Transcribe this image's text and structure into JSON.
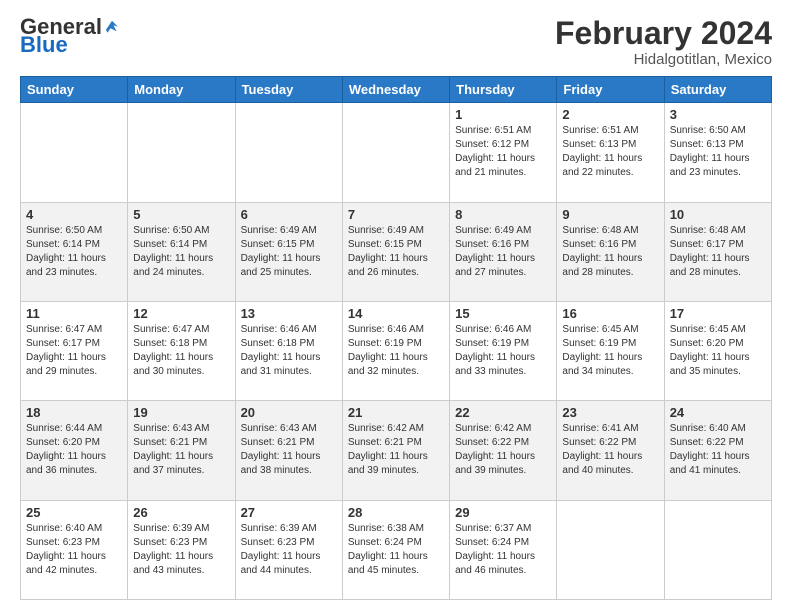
{
  "logo": {
    "general": "General",
    "blue": "Blue"
  },
  "title": "February 2024",
  "location": "Hidalgotitlan, Mexico",
  "days_of_week": [
    "Sunday",
    "Monday",
    "Tuesday",
    "Wednesday",
    "Thursday",
    "Friday",
    "Saturday"
  ],
  "weeks": [
    [
      {
        "day": "",
        "info": ""
      },
      {
        "day": "",
        "info": ""
      },
      {
        "day": "",
        "info": ""
      },
      {
        "day": "",
        "info": ""
      },
      {
        "day": "1",
        "info": "Sunrise: 6:51 AM\nSunset: 6:12 PM\nDaylight: 11 hours and 21 minutes."
      },
      {
        "day": "2",
        "info": "Sunrise: 6:51 AM\nSunset: 6:13 PM\nDaylight: 11 hours and 22 minutes."
      },
      {
        "day": "3",
        "info": "Sunrise: 6:50 AM\nSunset: 6:13 PM\nDaylight: 11 hours and 23 minutes."
      }
    ],
    [
      {
        "day": "4",
        "info": "Sunrise: 6:50 AM\nSunset: 6:14 PM\nDaylight: 11 hours and 23 minutes."
      },
      {
        "day": "5",
        "info": "Sunrise: 6:50 AM\nSunset: 6:14 PM\nDaylight: 11 hours and 24 minutes."
      },
      {
        "day": "6",
        "info": "Sunrise: 6:49 AM\nSunset: 6:15 PM\nDaylight: 11 hours and 25 minutes."
      },
      {
        "day": "7",
        "info": "Sunrise: 6:49 AM\nSunset: 6:15 PM\nDaylight: 11 hours and 26 minutes."
      },
      {
        "day": "8",
        "info": "Sunrise: 6:49 AM\nSunset: 6:16 PM\nDaylight: 11 hours and 27 minutes."
      },
      {
        "day": "9",
        "info": "Sunrise: 6:48 AM\nSunset: 6:16 PM\nDaylight: 11 hours and 28 minutes."
      },
      {
        "day": "10",
        "info": "Sunrise: 6:48 AM\nSunset: 6:17 PM\nDaylight: 11 hours and 28 minutes."
      }
    ],
    [
      {
        "day": "11",
        "info": "Sunrise: 6:47 AM\nSunset: 6:17 PM\nDaylight: 11 hours and 29 minutes."
      },
      {
        "day": "12",
        "info": "Sunrise: 6:47 AM\nSunset: 6:18 PM\nDaylight: 11 hours and 30 minutes."
      },
      {
        "day": "13",
        "info": "Sunrise: 6:46 AM\nSunset: 6:18 PM\nDaylight: 11 hours and 31 minutes."
      },
      {
        "day": "14",
        "info": "Sunrise: 6:46 AM\nSunset: 6:19 PM\nDaylight: 11 hours and 32 minutes."
      },
      {
        "day": "15",
        "info": "Sunrise: 6:46 AM\nSunset: 6:19 PM\nDaylight: 11 hours and 33 minutes."
      },
      {
        "day": "16",
        "info": "Sunrise: 6:45 AM\nSunset: 6:19 PM\nDaylight: 11 hours and 34 minutes."
      },
      {
        "day": "17",
        "info": "Sunrise: 6:45 AM\nSunset: 6:20 PM\nDaylight: 11 hours and 35 minutes."
      }
    ],
    [
      {
        "day": "18",
        "info": "Sunrise: 6:44 AM\nSunset: 6:20 PM\nDaylight: 11 hours and 36 minutes."
      },
      {
        "day": "19",
        "info": "Sunrise: 6:43 AM\nSunset: 6:21 PM\nDaylight: 11 hours and 37 minutes."
      },
      {
        "day": "20",
        "info": "Sunrise: 6:43 AM\nSunset: 6:21 PM\nDaylight: 11 hours and 38 minutes."
      },
      {
        "day": "21",
        "info": "Sunrise: 6:42 AM\nSunset: 6:21 PM\nDaylight: 11 hours and 39 minutes."
      },
      {
        "day": "22",
        "info": "Sunrise: 6:42 AM\nSunset: 6:22 PM\nDaylight: 11 hours and 39 minutes."
      },
      {
        "day": "23",
        "info": "Sunrise: 6:41 AM\nSunset: 6:22 PM\nDaylight: 11 hours and 40 minutes."
      },
      {
        "day": "24",
        "info": "Sunrise: 6:40 AM\nSunset: 6:22 PM\nDaylight: 11 hours and 41 minutes."
      }
    ],
    [
      {
        "day": "25",
        "info": "Sunrise: 6:40 AM\nSunset: 6:23 PM\nDaylight: 11 hours and 42 minutes."
      },
      {
        "day": "26",
        "info": "Sunrise: 6:39 AM\nSunset: 6:23 PM\nDaylight: 11 hours and 43 minutes."
      },
      {
        "day": "27",
        "info": "Sunrise: 6:39 AM\nSunset: 6:23 PM\nDaylight: 11 hours and 44 minutes."
      },
      {
        "day": "28",
        "info": "Sunrise: 6:38 AM\nSunset: 6:24 PM\nDaylight: 11 hours and 45 minutes."
      },
      {
        "day": "29",
        "info": "Sunrise: 6:37 AM\nSunset: 6:24 PM\nDaylight: 11 hours and 46 minutes."
      },
      {
        "day": "",
        "info": ""
      },
      {
        "day": "",
        "info": ""
      }
    ]
  ]
}
